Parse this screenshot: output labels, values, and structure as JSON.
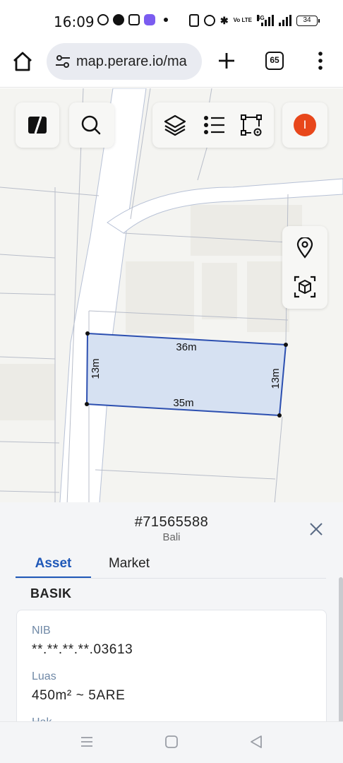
{
  "status_bar": {
    "time": "16:09",
    "battery": "34",
    "network": "4G",
    "volte": "Vo LTE"
  },
  "browser": {
    "url": "map.perare.io/ma",
    "tab_count": "65"
  },
  "map": {
    "buttons": [
      "logo",
      "search",
      "layers",
      "legend-list",
      "polygon-settings",
      "user-avatar",
      "location",
      "3d-view"
    ],
    "avatar_letter": "I",
    "avatar_color": "#e8471b",
    "parcel_fill": "#d6e1f2",
    "parcel_stroke": "#2c4fb0",
    "measurements": {
      "top": "36m",
      "bottom": "35m",
      "left": "13m",
      "right": "13m"
    }
  },
  "sheet": {
    "title": "#71565588",
    "subtitle": "Bali",
    "tabs": [
      "Asset",
      "Market"
    ],
    "active_tab": "Asset",
    "section_title": "BASIK",
    "fields": [
      {
        "label": "NIB",
        "value": "**.**.**.**.03613"
      },
      {
        "label": "Luas",
        "value": "450m² ~ 5ARE"
      },
      {
        "label": "Hak",
        "value": ""
      }
    ],
    "accent_color": "#1f58b8"
  }
}
